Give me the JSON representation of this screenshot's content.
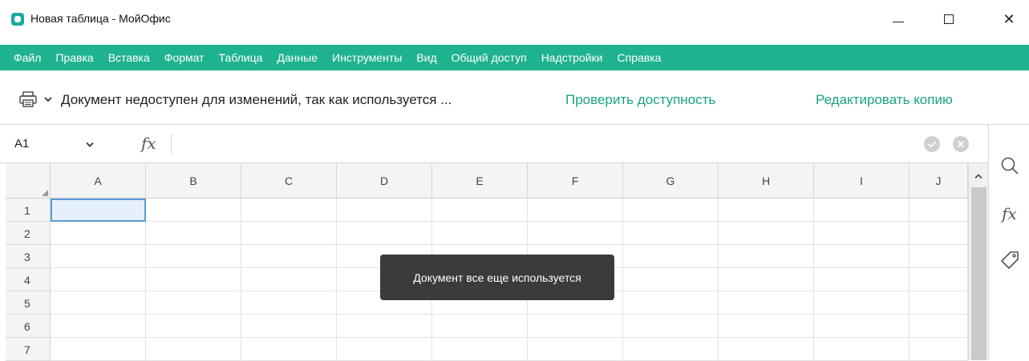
{
  "window": {
    "title": "Новая таблица - МойОфис",
    "close_glyph": "✕"
  },
  "menu": [
    "Файл",
    "Правка",
    "Вставка",
    "Формат",
    "Таблица",
    "Данные",
    "Инструменты",
    "Вид",
    "Общий доступ",
    "Надстройки",
    "Справка"
  ],
  "notice": {
    "icon": "printer-icon",
    "text": "Документ недоступен для изменений, так как используется ...",
    "check_link": "Проверить доступность",
    "copy_link": "Редактировать копию"
  },
  "formula": {
    "cell_ref": "A1",
    "fx_label": "fx",
    "value": ""
  },
  "sidebar": {
    "fx_label": "fx"
  },
  "sheet": {
    "columns": [
      "A",
      "B",
      "C",
      "D",
      "E",
      "F",
      "G",
      "H",
      "I",
      "J"
    ],
    "rows": [
      "1",
      "2",
      "3",
      "4",
      "5",
      "6",
      "7"
    ],
    "selected_cell": "A1"
  },
  "toast": {
    "text": "Документ все еще используется"
  },
  "colors": {
    "accent": "#1fb28f",
    "link": "#18a57f",
    "toast_bg": "#3b3b3b",
    "selection": "#5b9bd5"
  }
}
